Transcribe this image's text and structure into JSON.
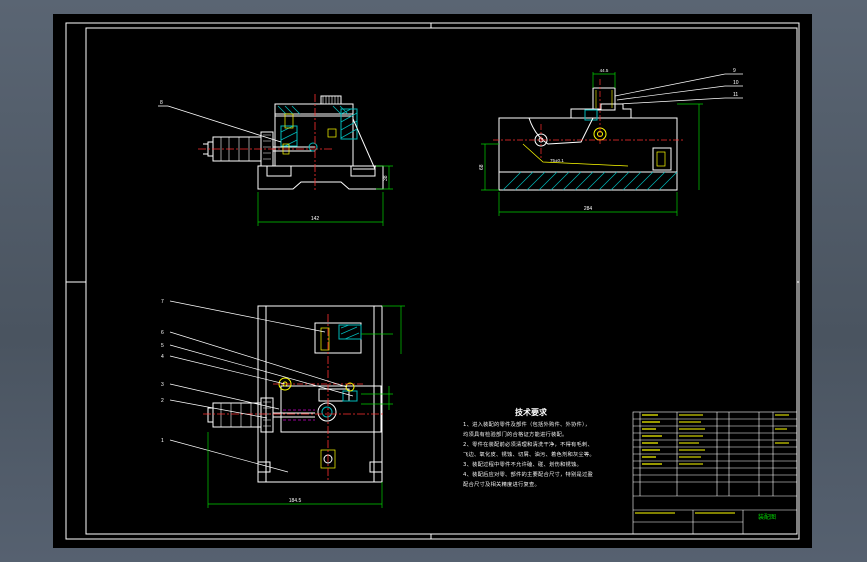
{
  "drawing": {
    "colors": {
      "background": "#000000",
      "frame": "#ffffff",
      "outline": "#ffffff",
      "hatch": "#00b8b8",
      "centerline": "#ff3030",
      "dimension": "#00d000",
      "leader": "#ffffff",
      "hidden": "#c800c8",
      "highlight": "#ffff00"
    },
    "top_left_view": {
      "part_label": "8",
      "dim_width": "142",
      "dim_height": "38"
    },
    "top_right_view": {
      "dim_width": "284",
      "dim_height": "68",
      "dim_top": "44.5",
      "callouts": [
        "9",
        "10",
        "11"
      ],
      "dim_inner": "75±0.1"
    },
    "bottom_view": {
      "callouts": [
        "7",
        "6",
        "5",
        "4",
        "3",
        "2",
        "1"
      ],
      "dim_width": "184.5"
    },
    "tech_requirements": {
      "title": "技术要求",
      "lines": [
        "1、进入装配的零件及部件（包括外购件、外协件），",
        "均须具有检验部门的合格证方能进行装配。",
        "2、零件在装配前必须清理和清洗干净，不得有毛刺、",
        "飞边、氧化皮、锈蚀、切屑、油污、着色剂和灰尘等。",
        "3、装配过程中零件不允许磕、碰、划伤和锈蚀。",
        "4、装配后应对零、部件的主要配合尺寸，特别是过盈",
        "配合尺寸及相关精度进行复查。"
      ]
    },
    "title_block": {
      "drawing_name": "装配图"
    }
  }
}
